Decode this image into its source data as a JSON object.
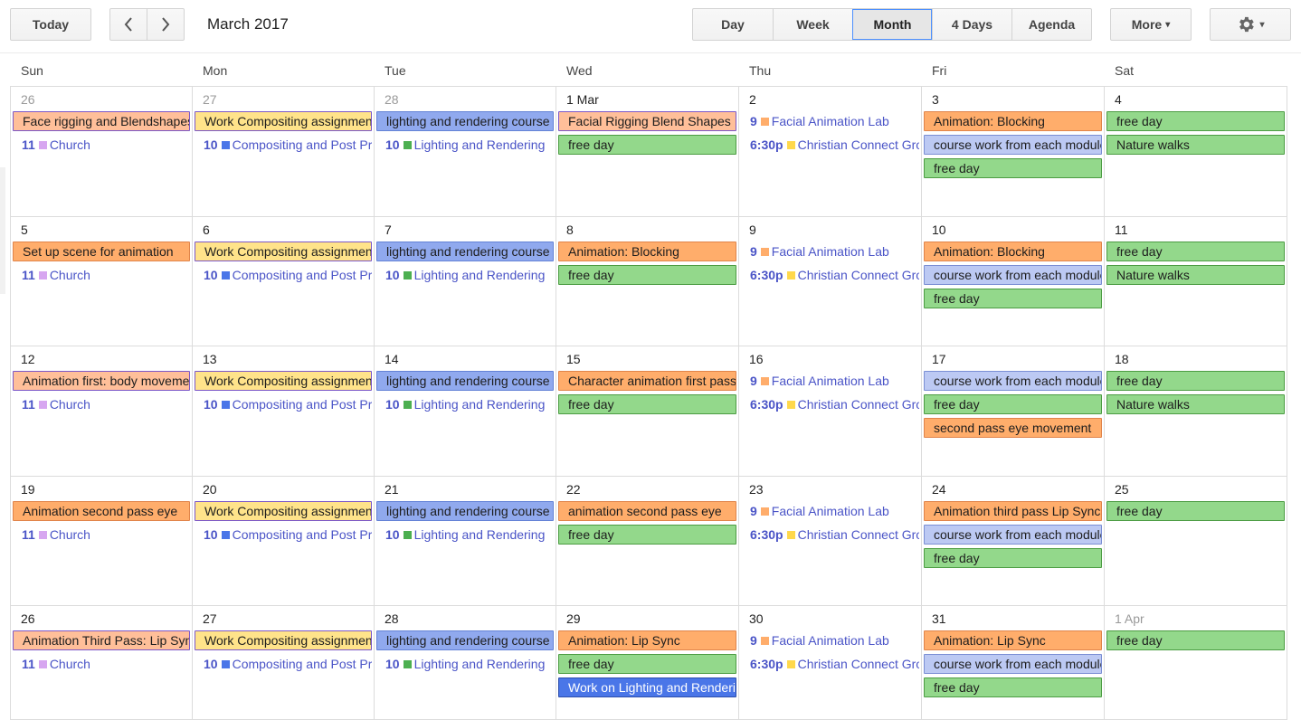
{
  "toolbar": {
    "today": "Today",
    "prev_icon": "chevron-left-icon",
    "next_icon": "chevron-right-icon",
    "title": "March 2017",
    "views": [
      "Day",
      "Week",
      "Month",
      "4 Days",
      "Agenda"
    ],
    "active_view": "Month",
    "more": "More",
    "more_caret": "▾",
    "settings_icon": "gear-icon",
    "settings_caret": "▾"
  },
  "weekdays": [
    "Sun",
    "Mon",
    "Tue",
    "Wed",
    "Thu",
    "Fri",
    "Sat"
  ],
  "colors": {
    "salmon": "#ffbf99",
    "orange": "#ffad6b",
    "yellow": "#ffe38a",
    "blue": "#90a9ee",
    "green": "#93d88b",
    "lavender": "#bcc9f3",
    "royal": "#4a76e8",
    "church_dot": "#d7a6f0",
    "compositing_dot": "#4a76e8",
    "lighting_dot": "#4caf50",
    "facial_dot": "#ffad6b",
    "christian_dot": "#ffd84d"
  },
  "weeks": [
    [
      {
        "label": "26",
        "other": true,
        "events": [
          {
            "kind": "bar",
            "color": "salmon",
            "text": "Face rigging and Blendshapes"
          },
          {
            "kind": "timed",
            "time": "11",
            "dot": "church_dot",
            "text": "Church"
          }
        ]
      },
      {
        "label": "27",
        "other": true,
        "events": [
          {
            "kind": "bar",
            "color": "yellow",
            "text": "Work Compositing assignment"
          },
          {
            "kind": "timed",
            "time": "10",
            "dot": "compositing_dot",
            "text": "Compositing and Post Production"
          }
        ]
      },
      {
        "label": "28",
        "other": true,
        "events": [
          {
            "kind": "bar",
            "color": "blue",
            "text": "lighting and rendering course"
          },
          {
            "kind": "timed",
            "time": "10",
            "dot": "lighting_dot",
            "text": "Lighting and Rendering"
          }
        ]
      },
      {
        "label": "1 Mar",
        "events": [
          {
            "kind": "bar",
            "color": "salmon",
            "text": "Facial Rigging Blend Shapes"
          },
          {
            "kind": "bar",
            "color": "green",
            "text": "free day"
          }
        ]
      },
      {
        "label": "2",
        "events": [
          {
            "kind": "timed",
            "time": "9",
            "dot": "facial_dot",
            "text": "Facial Animation Lab"
          },
          {
            "kind": "timed",
            "time": "6:30p",
            "dot": "christian_dot",
            "text": "Christian Connect Group"
          }
        ]
      },
      {
        "label": "3",
        "events": [
          {
            "kind": "bar",
            "color": "orange",
            "text": "Animation: Blocking"
          },
          {
            "kind": "bar",
            "color": "lavender",
            "text": "course work from each module"
          },
          {
            "kind": "bar",
            "color": "green",
            "text": "free day"
          }
        ]
      },
      {
        "label": "4",
        "events": [
          {
            "kind": "bar",
            "color": "green",
            "text": "free day"
          },
          {
            "kind": "bar",
            "color": "green",
            "text": "Nature walks"
          }
        ]
      }
    ],
    [
      {
        "label": "5",
        "events": [
          {
            "kind": "bar",
            "color": "orange",
            "text": "Set up scene for animation"
          },
          {
            "kind": "timed",
            "time": "11",
            "dot": "church_dot",
            "text": "Church"
          }
        ]
      },
      {
        "label": "6",
        "events": [
          {
            "kind": "bar",
            "color": "yellow",
            "text": "Work Compositing assignment"
          },
          {
            "kind": "timed",
            "time": "10",
            "dot": "compositing_dot",
            "text": "Compositing and Post Production"
          }
        ]
      },
      {
        "label": "7",
        "events": [
          {
            "kind": "bar",
            "color": "blue",
            "text": "lighting and rendering course"
          },
          {
            "kind": "timed",
            "time": "10",
            "dot": "lighting_dot",
            "text": "Lighting and Rendering"
          }
        ]
      },
      {
        "label": "8",
        "events": [
          {
            "kind": "bar",
            "color": "orange",
            "text": "Animation: Blocking"
          },
          {
            "kind": "bar",
            "color": "green",
            "text": "free day"
          }
        ]
      },
      {
        "label": "9",
        "events": [
          {
            "kind": "timed",
            "time": "9",
            "dot": "facial_dot",
            "text": "Facial Animation Lab"
          },
          {
            "kind": "timed",
            "time": "6:30p",
            "dot": "christian_dot",
            "text": "Christian Connect Group"
          }
        ]
      },
      {
        "label": "10",
        "events": [
          {
            "kind": "bar",
            "color": "orange",
            "text": "Animation: Blocking"
          },
          {
            "kind": "bar",
            "color": "lavender",
            "text": "course work from each module"
          },
          {
            "kind": "bar",
            "color": "green",
            "text": "free day"
          }
        ]
      },
      {
        "label": "11",
        "events": [
          {
            "kind": "bar",
            "color": "green",
            "text": "free day"
          },
          {
            "kind": "bar",
            "color": "green",
            "text": "Nature walks"
          }
        ]
      }
    ],
    [
      {
        "label": "12",
        "events": [
          {
            "kind": "bar",
            "color": "salmon",
            "text": "Animation first: body movement"
          },
          {
            "kind": "timed",
            "time": "11",
            "dot": "church_dot",
            "text": "Church"
          }
        ]
      },
      {
        "label": "13",
        "events": [
          {
            "kind": "bar",
            "color": "yellow",
            "text": "Work Compositing assignment"
          },
          {
            "kind": "timed",
            "time": "10",
            "dot": "compositing_dot",
            "text": "Compositing and Post Production"
          }
        ]
      },
      {
        "label": "14",
        "events": [
          {
            "kind": "bar",
            "color": "blue",
            "text": "lighting and rendering course"
          },
          {
            "kind": "timed",
            "time": "10",
            "dot": "lighting_dot",
            "text": "Lighting and Rendering"
          }
        ]
      },
      {
        "label": "15",
        "events": [
          {
            "kind": "bar",
            "color": "orange",
            "text": "Character animation first pass"
          },
          {
            "kind": "bar",
            "color": "green",
            "text": "free day"
          }
        ]
      },
      {
        "label": "16",
        "events": [
          {
            "kind": "timed",
            "time": "9",
            "dot": "facial_dot",
            "text": "Facial Animation Lab"
          },
          {
            "kind": "timed",
            "time": "6:30p",
            "dot": "christian_dot",
            "text": "Christian Connect Group"
          }
        ]
      },
      {
        "label": "17",
        "events": [
          {
            "kind": "bar",
            "color": "lavender",
            "text": "course work from each module"
          },
          {
            "kind": "bar",
            "color": "green",
            "text": "free day"
          },
          {
            "kind": "bar",
            "color": "orange",
            "text": "second pass eye movement"
          }
        ]
      },
      {
        "label": "18",
        "events": [
          {
            "kind": "bar",
            "color": "green",
            "text": "free day"
          },
          {
            "kind": "bar",
            "color": "green",
            "text": "Nature walks"
          }
        ]
      }
    ],
    [
      {
        "label": "19",
        "events": [
          {
            "kind": "bar",
            "color": "orange",
            "text": "Animation second pass eye"
          },
          {
            "kind": "timed",
            "time": "11",
            "dot": "church_dot",
            "text": "Church"
          }
        ]
      },
      {
        "label": "20",
        "events": [
          {
            "kind": "bar",
            "color": "yellow",
            "text": "Work Compositing assignment"
          },
          {
            "kind": "timed",
            "time": "10",
            "dot": "compositing_dot",
            "text": "Compositing and Post Production"
          }
        ]
      },
      {
        "label": "21",
        "events": [
          {
            "kind": "bar",
            "color": "blue",
            "text": "lighting and rendering course"
          },
          {
            "kind": "timed",
            "time": "10",
            "dot": "lighting_dot",
            "text": "Lighting and Rendering"
          }
        ]
      },
      {
        "label": "22",
        "events": [
          {
            "kind": "bar",
            "color": "orange",
            "text": "animation second pass eye"
          },
          {
            "kind": "bar",
            "color": "green",
            "text": "free day"
          }
        ]
      },
      {
        "label": "23",
        "events": [
          {
            "kind": "timed",
            "time": "9",
            "dot": "facial_dot",
            "text": "Facial Animation Lab"
          },
          {
            "kind": "timed",
            "time": "6:30p",
            "dot": "christian_dot",
            "text": "Christian Connect Group"
          }
        ]
      },
      {
        "label": "24",
        "events": [
          {
            "kind": "bar",
            "color": "orange",
            "text": "Animation third pass Lip Sync"
          },
          {
            "kind": "bar",
            "color": "lavender",
            "text": "course work from each module"
          },
          {
            "kind": "bar",
            "color": "green",
            "text": "free day"
          }
        ]
      },
      {
        "label": "25",
        "events": [
          {
            "kind": "bar",
            "color": "green",
            "text": "free day"
          }
        ]
      }
    ],
    [
      {
        "label": "26",
        "events": [
          {
            "kind": "bar",
            "color": "salmon",
            "text": "Animation Third Pass: Lip Sync"
          },
          {
            "kind": "timed",
            "time": "11",
            "dot": "church_dot",
            "text": "Church"
          }
        ]
      },
      {
        "label": "27",
        "events": [
          {
            "kind": "bar",
            "color": "yellow",
            "text": "Work Compositing assignment"
          },
          {
            "kind": "timed",
            "time": "10",
            "dot": "compositing_dot",
            "text": "Compositing and Post Production"
          }
        ]
      },
      {
        "label": "28",
        "events": [
          {
            "kind": "bar",
            "color": "blue",
            "text": "lighting and rendering course"
          },
          {
            "kind": "timed",
            "time": "10",
            "dot": "lighting_dot",
            "text": "Lighting and Rendering"
          }
        ]
      },
      {
        "label": "29",
        "events": [
          {
            "kind": "bar",
            "color": "orange",
            "text": "Animation: Lip Sync"
          },
          {
            "kind": "bar",
            "color": "green",
            "text": "free day"
          },
          {
            "kind": "bar",
            "color": "royal",
            "text": "Work on Lighting and Rendering"
          }
        ]
      },
      {
        "label": "30",
        "events": [
          {
            "kind": "timed",
            "time": "9",
            "dot": "facial_dot",
            "text": "Facial Animation Lab"
          },
          {
            "kind": "timed",
            "time": "6:30p",
            "dot": "christian_dot",
            "text": "Christian Connect Group"
          }
        ]
      },
      {
        "label": "31",
        "events": [
          {
            "kind": "bar",
            "color": "orange",
            "text": "Animation: Lip Sync"
          },
          {
            "kind": "bar",
            "color": "lavender",
            "text": "course work from each module"
          },
          {
            "kind": "bar",
            "color": "green",
            "text": "free day"
          }
        ]
      },
      {
        "label": "1 Apr",
        "other": true,
        "events": [
          {
            "kind": "bar",
            "color": "green",
            "text": "free day"
          }
        ]
      }
    ]
  ]
}
